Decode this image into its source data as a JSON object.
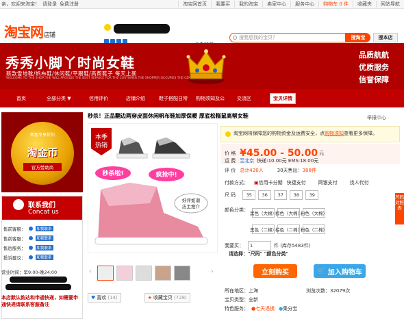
{
  "topbar": {
    "greeting": "亲，欢迎来淘宝！",
    "login": "请登录",
    "register": "免费注册",
    "links": [
      "淘宝网首页",
      "我要买",
      "我的淘宝",
      "卖家中心",
      "服务中心"
    ],
    "cart": "购物车 0 件",
    "favorites": "收藏夹",
    "sitenav": "网站导航"
  },
  "header": {
    "logo": "淘宝网",
    "logo_suffix": "店铺",
    "fav_shop": "点击收藏",
    "search_placeholder": "搜我想找的宝贝？",
    "search_taobao": "搜淘宝",
    "search_shop": "搜本店"
  },
  "banner": {
    "title": "秀秀小脚丫时尚女鞋",
    "subtitle": "新款雪地靴/帆布鞋/休闲鞋/平跟鞋/高帮鞋子  每天上新",
    "english": "WELCOME TO THE SHOP,THE WILL PROVIDE THE BEST SERVICE FOR THE CUSTOMER THE SHOPPER OCCUPIES THE CENTRAL POSITION",
    "slogans": [
      "品质航航",
      "优质服务",
      "信誉保障"
    ]
  },
  "nav": {
    "items": [
      "首页",
      "全部分类 ▼",
      "信用评价",
      "店铺介绍",
      "鞋子搭配日常",
      "购物须知及公",
      "交流区"
    ],
    "active": "宝贝详情"
  },
  "leftad": {
    "top": "新客专享折扣",
    "main": "淘金币",
    "bottom": "官方赞助商"
  },
  "contact": {
    "title": "联系我们",
    "subtitle": "Concat us",
    "rows": [
      {
        "label": "售前客服：",
        "badge": "和我联系"
      },
      {
        "label": "售前客服：",
        "badge": "和我联系"
      },
      {
        "label": "售后服务：",
        "badge": "和我联系"
      },
      {
        "label": "投诉建议：",
        "badge": "和我联系"
      }
    ],
    "hours": "营业时间：早9:00-晚24:00",
    "note": "本店默认韵达和申通快递，如需要申通快递请联系客服备注"
  },
  "product": {
    "title": "秒杀！正品翻边两穿皮面休闲帆布鞋加厚保暖 厚底松糕鼠高帮女鞋",
    "report": "举报中心",
    "promo_msg": "淘宝网将保障您的购物资金及运费安全，点",
    "promo_link": "购物须知",
    "promo_tail": "查看更多保障。",
    "price_label": "价    格",
    "price": "¥45.00 - 50.00",
    "price_unit": "元",
    "ship_label": "运    费",
    "ship_from": "至北京",
    "ship_info": "快递:10.00元 EMS:18.00元",
    "rating_label": "评    价",
    "rating_total": "总计426人",
    "sales": "30天售出：",
    "sales_count": "388件",
    "payment_label": "付款方式：",
    "payments": [
      "信用卡分期",
      "快捷支付",
      "网银支付",
      "找人代付"
    ],
    "size_label": "尺    码",
    "sizes": [
      "35",
      "36",
      "37",
      "38",
      "39"
    ],
    "color_label": "颜色分类：",
    "colors": [
      "黑色（大棉）",
      "棕色（大棉）",
      "粉色（大棉）",
      "黑色（二棉）",
      "棕色（二棉）",
      "粉色（二棉）"
    ],
    "qty_label": "我要买：",
    "qty": "1",
    "stock": "件 (库存5483件)",
    "select_note": "请选择：\"尺码\" \"颜色分类\"",
    "buy": "立刻购买",
    "addcart": "加入购物车",
    "location_label": "所在地区：",
    "location": "上海",
    "views": "浏览次数：32079次",
    "condition_label": "宝贝类型：",
    "condition": "全新",
    "service_label": "特色服务：",
    "service1": "七天退换",
    "service2": "集分宝",
    "like": "喜欢",
    "like_count": "(14)",
    "collect": "收藏宝贝",
    "collect_count": "(728)",
    "img_badge": "本季热销",
    "img_tag1": "秒杀啦!",
    "img_tag2": "疯抢中!",
    "img_tag3": "好评如潮 店主推介",
    "sidetab": "尺码对照表"
  },
  "colors": {
    "brand": "#ff4400",
    "banner": "#b10000",
    "nav": "#c20000",
    "cart": "#39a7e8",
    "buy": "#ff6600"
  }
}
